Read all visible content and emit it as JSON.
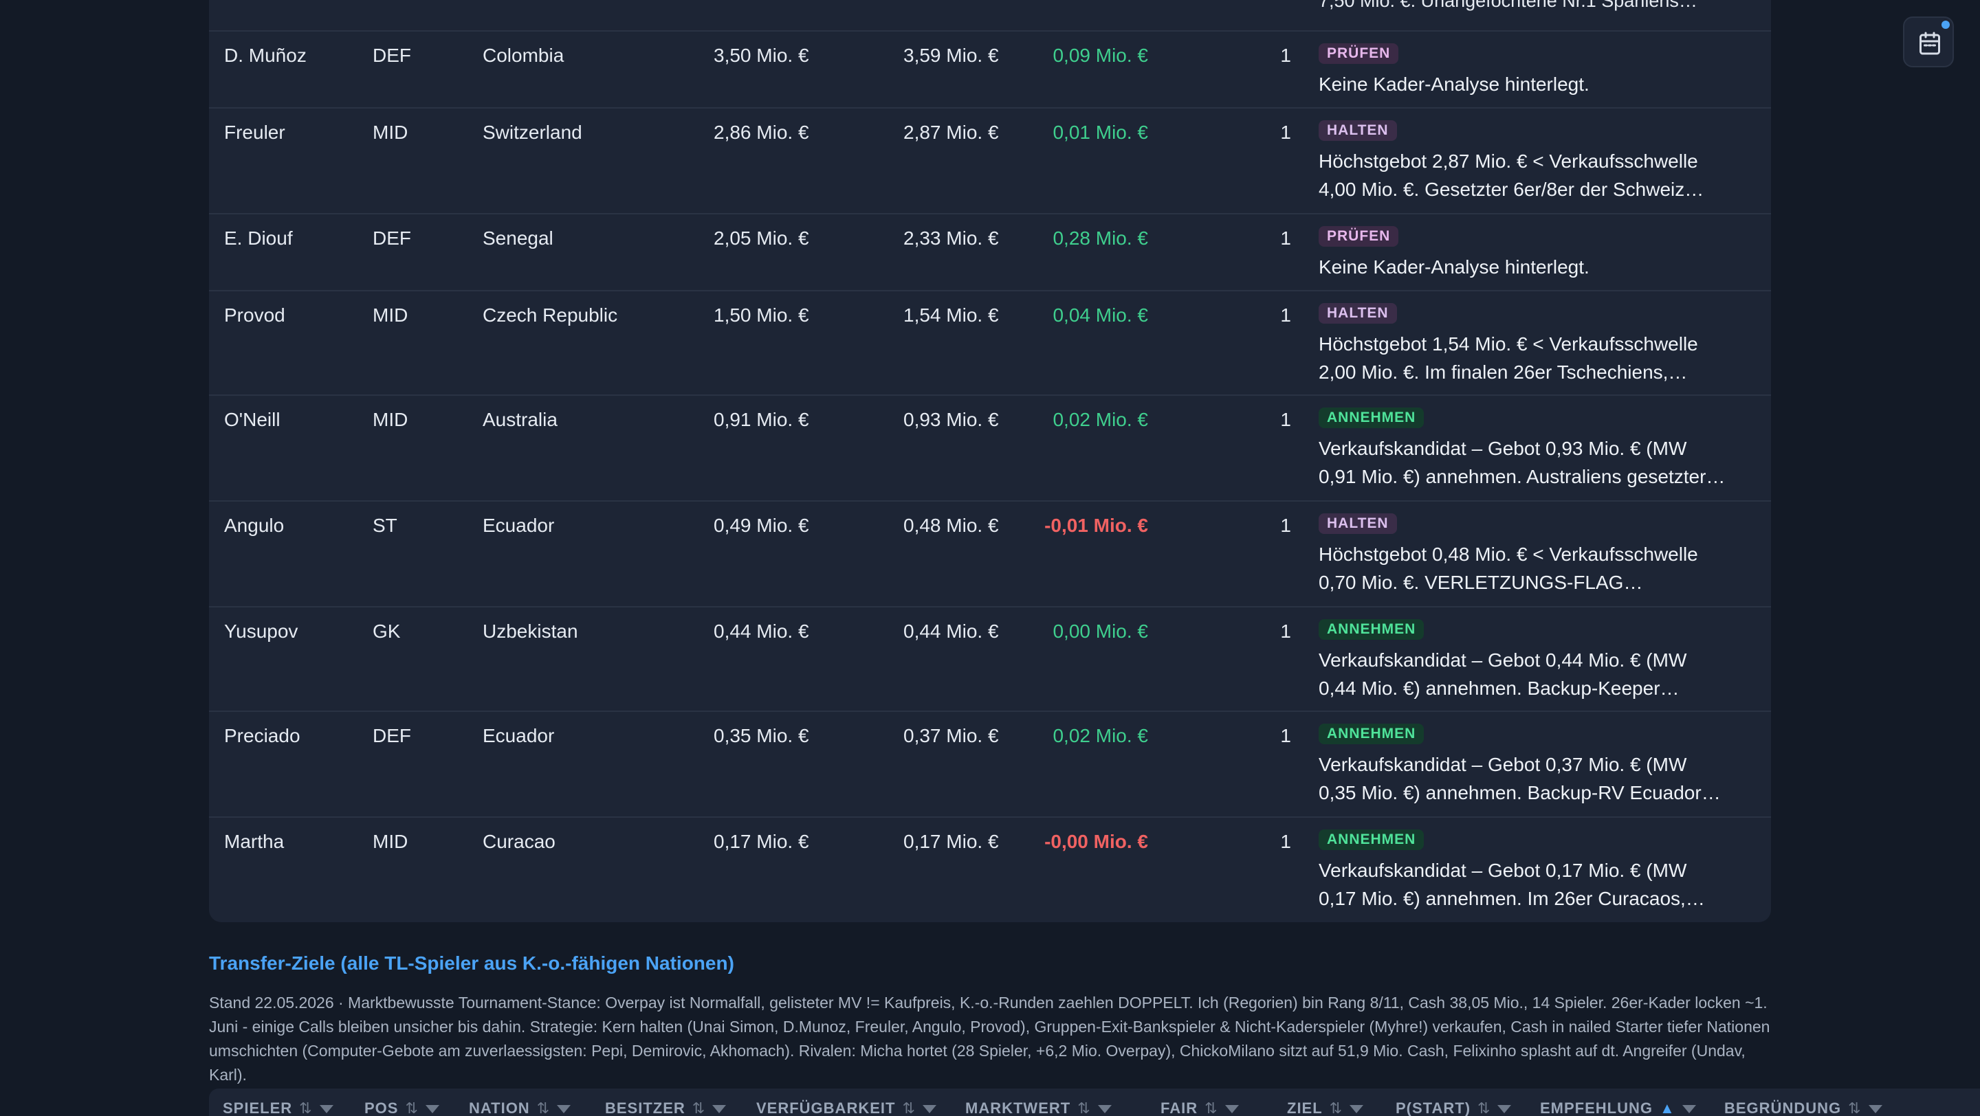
{
  "partial_row": {
    "reason": "7,50 Mio. €. Unangefochtene Nr.1 Spaniens…"
  },
  "rows": [
    {
      "name": "D. Muñoz",
      "pos": "DEF",
      "nation": "Colombia",
      "mv": "3,50 Mio. €",
      "fair": "3,59 Mio. €",
      "diff": "0,09 Mio. €",
      "diff_sign": "pos",
      "prob": "1",
      "rec": "PRÜFEN",
      "rec_class": "pruefen",
      "reason1": "Keine Kader-Analyse hinterlegt.",
      "reason2": ""
    },
    {
      "name": "Freuler",
      "pos": "MID",
      "nation": "Switzerland",
      "mv": "2,86 Mio. €",
      "fair": "2,87 Mio. €",
      "diff": "0,01 Mio. €",
      "diff_sign": "pos",
      "prob": "1",
      "rec": "HALTEN",
      "rec_class": "halten",
      "reason1": "Höchstgebot 2,87 Mio. € < Verkaufsschwelle",
      "reason2": "4,00 Mio. €. Gesetzter 6er/8er der Schweiz…"
    },
    {
      "name": "E. Diouf",
      "pos": "DEF",
      "nation": "Senegal",
      "mv": "2,05 Mio. €",
      "fair": "2,33 Mio. €",
      "diff": "0,28 Mio. €",
      "diff_sign": "pos",
      "prob": "1",
      "rec": "PRÜFEN",
      "rec_class": "pruefen",
      "reason1": "Keine Kader-Analyse hinterlegt.",
      "reason2": ""
    },
    {
      "name": "Provod",
      "pos": "MID",
      "nation": "Czech Republic",
      "mv": "1,50 Mio. €",
      "fair": "1,54 Mio. €",
      "diff": "0,04 Mio. €",
      "diff_sign": "pos",
      "prob": "1",
      "rec": "HALTEN",
      "rec_class": "halten",
      "reason1": "Höchstgebot 1,54 Mio. € < Verkaufsschwelle",
      "reason2": "2,00 Mio. €. Im finalen 26er Tschechiens,…"
    },
    {
      "name": "O'Neill",
      "pos": "MID",
      "nation": "Australia",
      "mv": "0,91 Mio. €",
      "fair": "0,93 Mio. €",
      "diff": "0,02 Mio. €",
      "diff_sign": "pos",
      "prob": "1",
      "rec": "ANNEHMEN",
      "rec_class": "annehmen",
      "reason1": "Verkaufskandidat – Gebot 0,93 Mio. € (MW",
      "reason2": "0,91 Mio. €) annehmen. Australiens gesetzter…"
    },
    {
      "name": "Angulo",
      "pos": "ST",
      "nation": "Ecuador",
      "mv": "0,49 Mio. €",
      "fair": "0,48 Mio. €",
      "diff": "-0,01 Mio. €",
      "diff_sign": "neg",
      "prob": "1",
      "rec": "HALTEN",
      "rec_class": "halten",
      "reason1": "Höchstgebot 0,48 Mio. € < Verkaufsschwelle",
      "reason2": "0,70 Mio. €. VERLETZUNGS-FLAG…"
    },
    {
      "name": "Yusupov",
      "pos": "GK",
      "nation": "Uzbekistan",
      "mv": "0,44 Mio. €",
      "fair": "0,44 Mio. €",
      "diff": "0,00 Mio. €",
      "diff_sign": "pos",
      "prob": "1",
      "rec": "ANNEHMEN",
      "rec_class": "annehmen",
      "reason1": "Verkaufskandidat – Gebot 0,44 Mio. € (MW",
      "reason2": "0,44 Mio. €) annehmen. Backup-Keeper…"
    },
    {
      "name": "Preciado",
      "pos": "DEF",
      "nation": "Ecuador",
      "mv": "0,35 Mio. €",
      "fair": "0,37 Mio. €",
      "diff": "0,02 Mio. €",
      "diff_sign": "pos",
      "prob": "1",
      "rec": "ANNEHMEN",
      "rec_class": "annehmen",
      "reason1": "Verkaufskandidat – Gebot 0,37 Mio. € (MW",
      "reason2": "0,35 Mio. €) annehmen. Backup-RV Ecuador…"
    },
    {
      "name": "Martha",
      "pos": "MID",
      "nation": "Curacao",
      "mv": "0,17 Mio. €",
      "fair": "0,17 Mio. €",
      "diff": "-0,00 Mio. €",
      "diff_sign": "neg",
      "prob": "1",
      "rec": "ANNEHMEN",
      "rec_class": "annehmen",
      "reason1": "Verkaufskandidat – Gebot 0,17 Mio. € (MW",
      "reason2": "0,17 Mio. €) annehmen. Im 26er Curacaos,…"
    }
  ],
  "transfer": {
    "title": "Transfer-Ziele (alle TL-Spieler aus K.-o.-fähigen Nationen)",
    "description": "Stand 22.05.2026 · Marktbewusste Tournament-Stance: Overpay ist Normalfall, gelisteter MV != Kaufpreis, K.-o.-Runden zaehlen DOPPELT. Ich (Regorien) bin Rang 8/11, Cash 38,05 Mio., 14 Spieler. 26er-Kader locken ~1. Juni - einige Calls bleiben unsicher bis dahin. Strategie: Kern halten (Unai Simon, D.Munoz, Freuler, Angulo, Provod), Gruppen-Exit-Bankspieler & Nicht-Kaderspieler (Myhre!) verkaufen, Cash in nailed Starter tiefer Nationen umschichten (Computer-Gebote am zuverlaessigsten: Pepi, Demirovic, Akhomach). Rivalen: Micha hortet (28 Spieler, +6,2 Mio. Overpay), ChickoMilano sitzt auf 51,9 Mio. Cash, Felixinho splasht auf dt. Angreifer (Undav, Karl)."
  },
  "table_header": {
    "columns": [
      {
        "label": "SPIELER",
        "sort": "⇅",
        "active": false
      },
      {
        "label": "POS",
        "sort": "⇅",
        "active": false
      },
      {
        "label": "NATION",
        "sort": "⇅",
        "active": false
      },
      {
        "label": "BESITZER",
        "sort": "⇅",
        "active": false
      },
      {
        "label": "VERFÜGBARKEIT",
        "sort": "⇅",
        "active": false
      },
      {
        "label": "MARKTWERT",
        "sort": "⇅",
        "active": false
      },
      {
        "label": "FAIR",
        "sort": "⇅",
        "active": false
      },
      {
        "label": "ZIEL",
        "sort": "⇅",
        "active": false
      },
      {
        "label": "P(START)",
        "sort": "⇅",
        "active": false
      },
      {
        "label": "EMPFEHLUNG",
        "sort": "▲",
        "active": true
      },
      {
        "label": "BEGRÜNDUNG",
        "sort": "⇅",
        "active": false
      }
    ]
  },
  "icons": {
    "calendar": "calendar-icon"
  },
  "colors": {
    "background": "#131a26",
    "panel": "#1d2535",
    "positive": "#3fcf8e",
    "negative": "#f06262",
    "accent": "#4ba3f5"
  }
}
